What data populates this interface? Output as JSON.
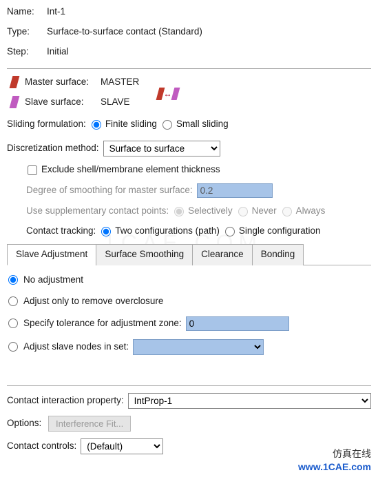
{
  "header": {
    "name_label": "Name:",
    "name_value": "Int-1",
    "type_label": "Type:",
    "type_value": "Surface-to-surface contact (Standard)",
    "step_label": "Step:",
    "step_value": "Initial"
  },
  "surfaces": {
    "master_label": "Master surface:",
    "master_value": "MASTER",
    "slave_label": "Slave surface:",
    "slave_value": "SLAVE"
  },
  "sliding": {
    "label": "Sliding formulation:",
    "finite": "Finite sliding",
    "small": "Small sliding"
  },
  "discretization": {
    "label": "Discretization method:",
    "value": "Surface to surface",
    "exclude": "Exclude shell/membrane element thickness",
    "smooth_label": "Degree of smoothing for master surface:",
    "smooth_value": "0.2",
    "supp_label": "Use supplementary contact points:",
    "supp_sel": "Selectively",
    "supp_never": "Never",
    "supp_always": "Always"
  },
  "tracking": {
    "label": "Contact tracking:",
    "two": "Two configurations (path)",
    "single": "Single configuration"
  },
  "tabs": {
    "slave": "Slave Adjustment",
    "smooth": "Surface Smoothing",
    "clear": "Clearance",
    "bond": "Bonding"
  },
  "adjust": {
    "none": "No adjustment",
    "over": "Adjust only to remove overclosure",
    "tol": "Specify tolerance for adjustment zone:",
    "tol_val": "0",
    "set": "Adjust slave nodes in set:"
  },
  "bottom": {
    "prop_label": "Contact interaction property:",
    "prop_value": "IntProp-1",
    "opt_label": "Options:",
    "opt_btn": "Interference Fit...",
    "ctrl_label": "Contact controls:",
    "ctrl_value": "(Default)"
  },
  "watermark": {
    "cn": "仿真在线",
    "site": "www.1CAE.com"
  }
}
